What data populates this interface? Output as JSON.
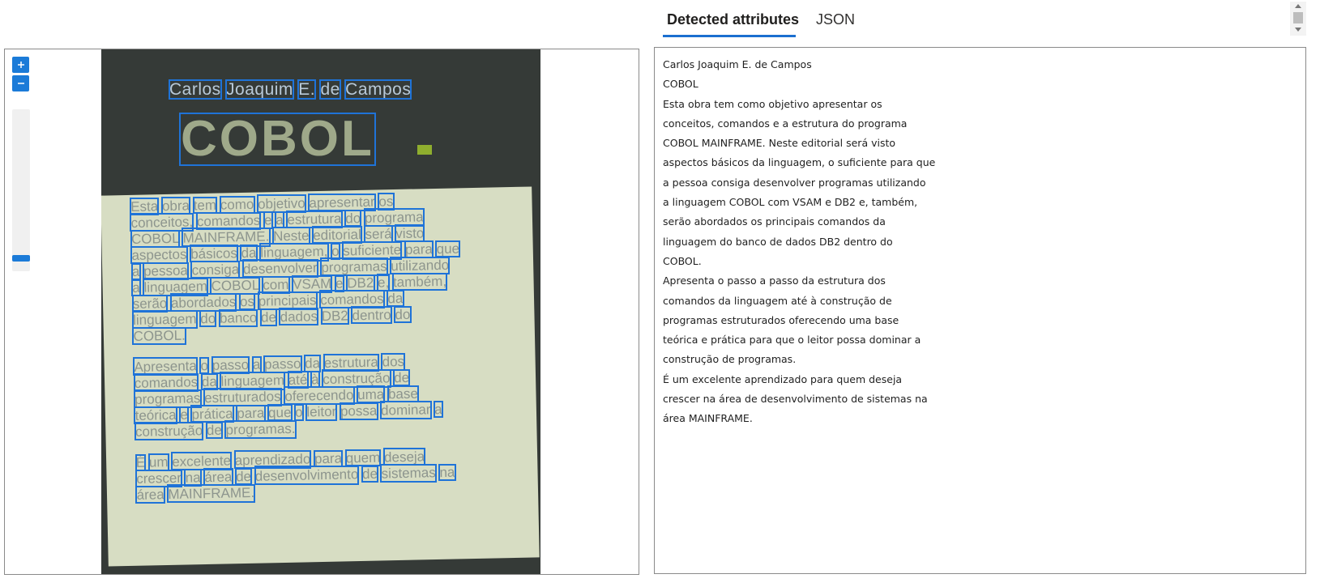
{
  "tabs": {
    "detected": "Detected attributes",
    "json": "JSON"
  },
  "viewer": {
    "zoom_in_icon": "plus-icon",
    "zoom_out_icon": "minus-icon"
  },
  "photo": {
    "author": "Carlos Joaquim E. de Campos",
    "title": "COBOL",
    "paragraph1": [
      "Esta obra tem como objetivo apresentar os",
      "conceitos, comandos e a estrutura do programa",
      "COBOL MAINFRAME. Neste editorial será visto",
      "aspectos básicos da linguagem, o suficiente para que",
      "a pessoa consiga desenvolver programas utilizando",
      "a linguagem COBOL com VSAM e DB2 e, também,",
      "serão abordados os principais comandos da",
      "linguagem do banco de dados DB2 dentro do",
      "COBOL."
    ],
    "paragraph2": [
      "Apresenta o passo a passo da estrutura dos",
      "comandos da linguagem até à construção de",
      "programas estruturados oferecendo uma base",
      "teórica e prática para que o leitor possa dominar a",
      "construção de programas."
    ],
    "paragraph3": [
      "É um excelente aprendizado para quem deseja",
      "crescer na área de desenvolvimento de sistemas na",
      "área MAINFRAME."
    ]
  },
  "attributes": {
    "lines": [
      "Carlos Joaquim E. de Campos",
      "COBOL",
      "Esta obra tem como objetivo apresentar os",
      "conceitos, comandos e a estrutura do programa",
      "COBOL MAINFRAME. Neste editorial será visto",
      "aspectos básicos da linguagem, o suficiente para que",
      "a pessoa consiga desenvolver programas utilizando",
      "a linguagem COBOL com VSAM e DB2 e, também,",
      "serão abordados os principais comandos da",
      "linguagem do banco de dados DB2 dentro do",
      "COBOL.",
      "Apresenta o passo a passo da estrutura dos",
      "comandos da linguagem até à construção de",
      "programas estruturados oferecendo uma base",
      "teórica e prática para que o leitor possa dominar a",
      "construção de programas.",
      "É um excelente aprendizado para quem deseja",
      "crescer na área de desenvolvimento de sistemas na",
      "área MAINFRAME."
    ]
  },
  "colors": {
    "accent": "#1b7bd8",
    "ocr_box": "#1f73d8"
  }
}
